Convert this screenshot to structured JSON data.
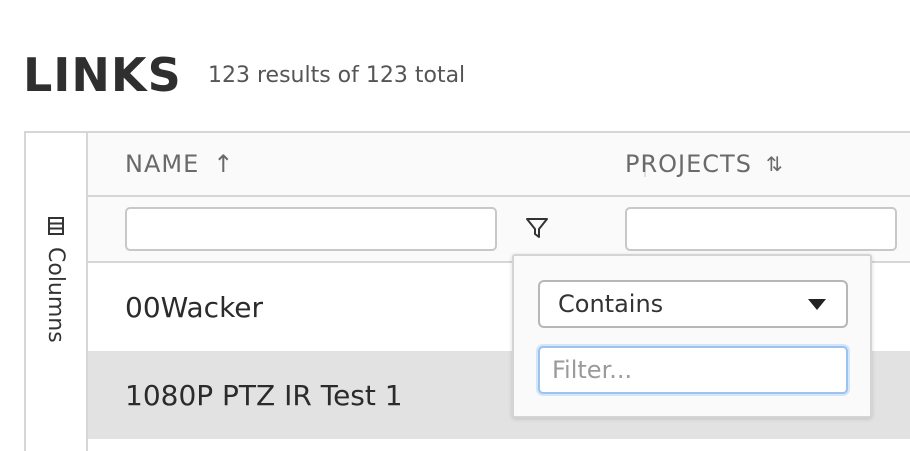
{
  "page": {
    "title": "LINKS",
    "result_count": "123 results of 123 total"
  },
  "side_panel": {
    "columns_label": "Columns",
    "columns_icon": "columns-icon"
  },
  "columns": [
    {
      "label": "NAME",
      "sort_icon": "↑"
    },
    {
      "label": "PROJECTS",
      "sort_icon": "⇅"
    }
  ],
  "rows": [
    {
      "name": "00Wacker"
    },
    {
      "name": "1080P PTZ IR Test 1"
    }
  ],
  "filter_popup": {
    "operator": "Contains",
    "placeholder": "Filter..."
  },
  "colors": {
    "border": "#d6d6d6",
    "selected_row": "#e2e2e2",
    "focus": "#9cc3ef"
  }
}
